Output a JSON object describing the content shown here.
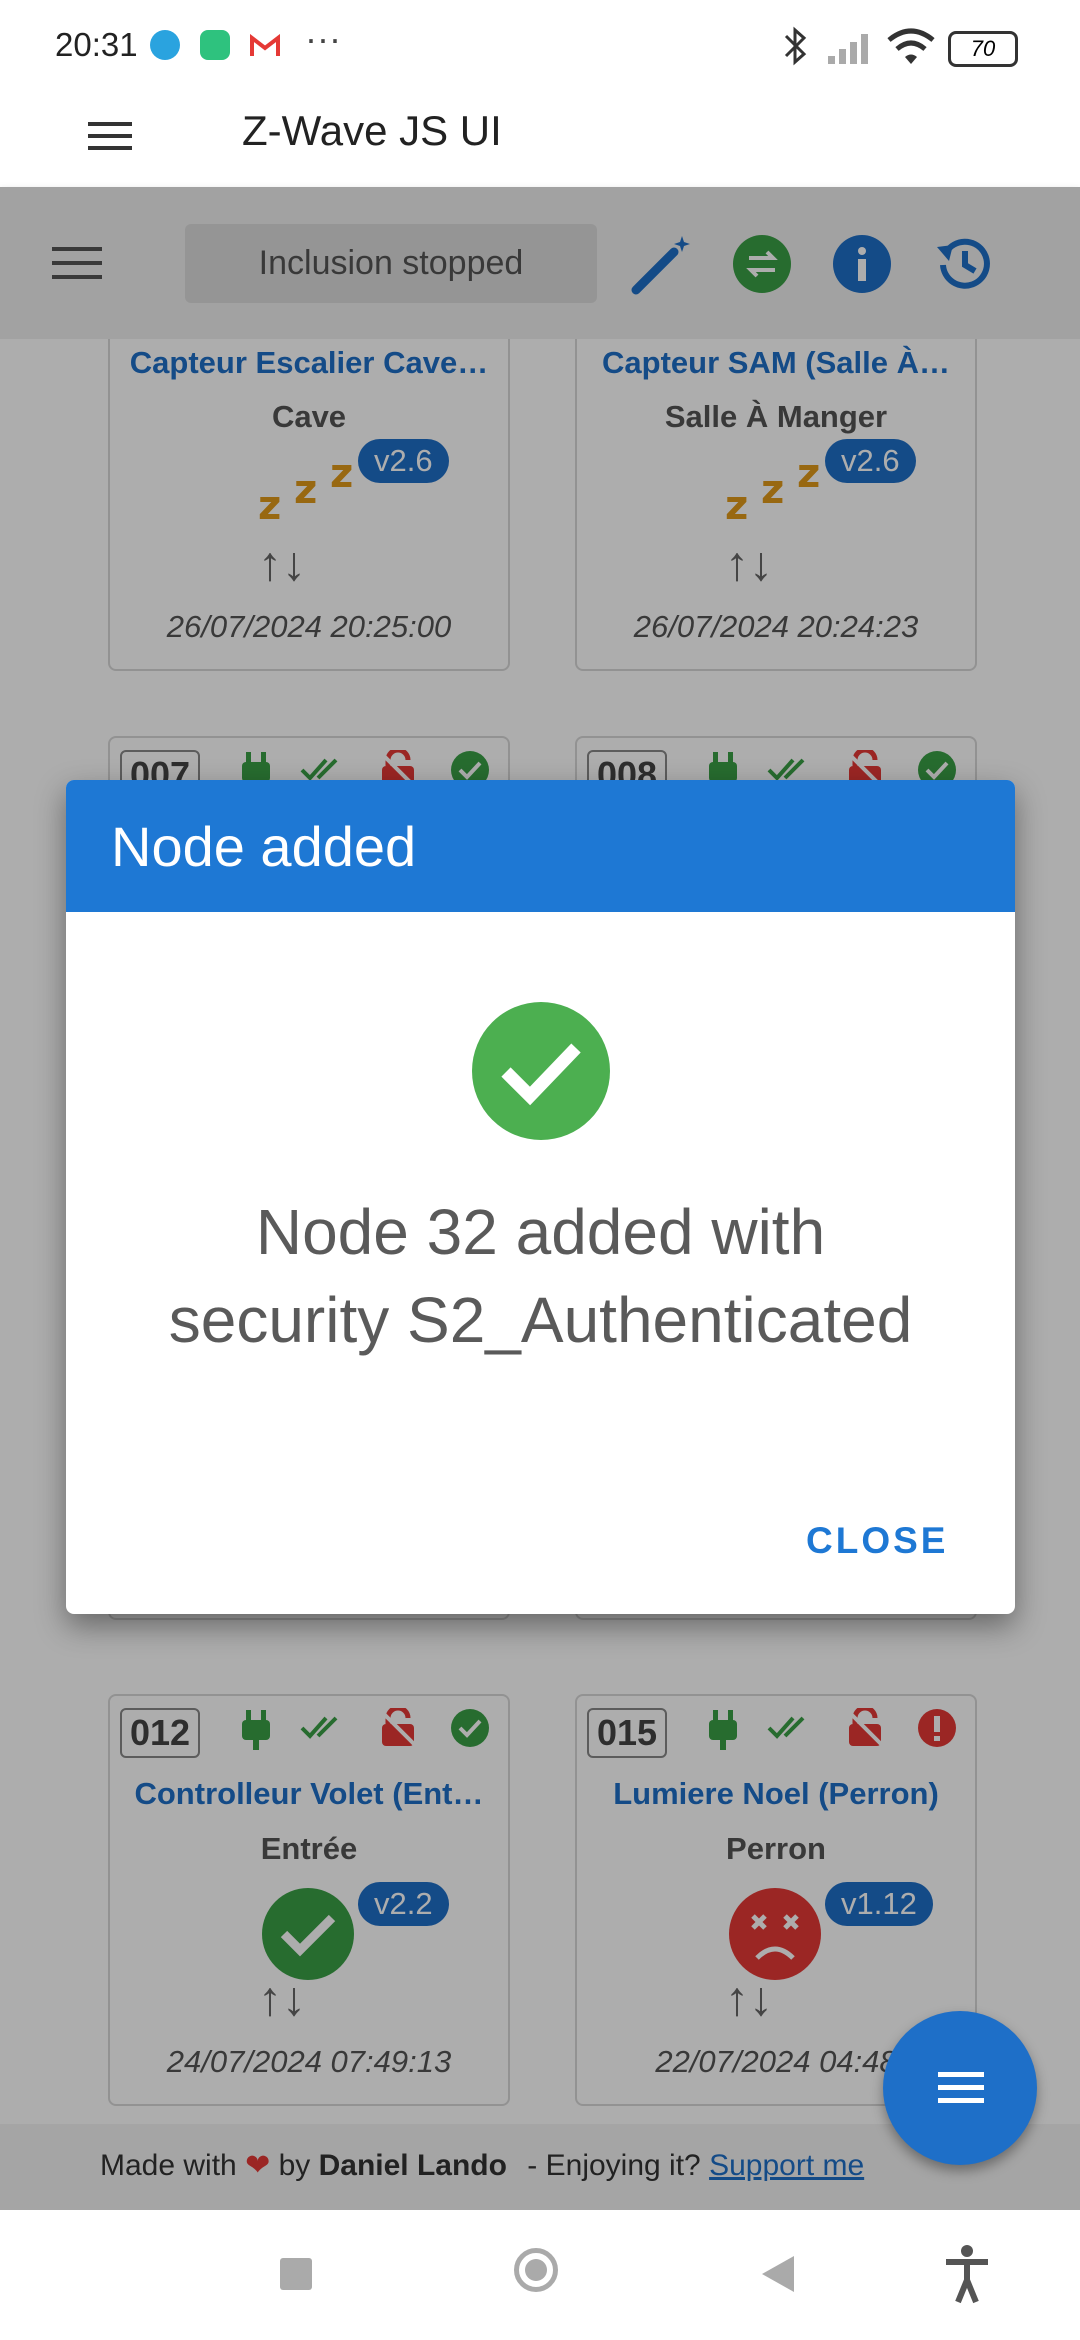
{
  "status_bar": {
    "time": "20:31",
    "battery": "70",
    "more": "···"
  },
  "app_bar": {
    "title": "Z-Wave JS UI"
  },
  "toolbar": {
    "inclusion_status": "Inclusion stopped"
  },
  "cards": [
    {
      "name": "Capteur Escalier Cave…",
      "location": "Cave",
      "version": "v2.6",
      "date": "26/07/2024 20:25:00"
    },
    {
      "name": "Capteur SAM (Salle À…",
      "location": "Salle À Manger",
      "version": "v2.6",
      "date": "26/07/2024 20:24:23"
    },
    {
      "id": "007"
    },
    {
      "id": "008"
    },
    {
      "id": "012",
      "name": "Controlleur Volet (Ent…",
      "location": "Entrée",
      "version": "v2.2",
      "date": "24/07/2024 07:49:13"
    },
    {
      "id": "015",
      "name": "Lumiere Noel (Perron)",
      "location": "Perron",
      "version": "v1.12",
      "date": "22/07/2024 04:48"
    }
  ],
  "footer": {
    "made_with": "Made with",
    "by": "by",
    "author": "Daniel Lando",
    "enjoy": "- Enjoying it?",
    "support": "Support me"
  },
  "dialog": {
    "title": "Node added",
    "message_line1": "Node 32 added with",
    "message_line2": "security S2_Authenticated",
    "close_label": "CLOSE"
  },
  "colors": {
    "primary": "#1e78d4",
    "success": "#4caf50",
    "error": "#e53935",
    "sleep": "#e09a1a"
  }
}
